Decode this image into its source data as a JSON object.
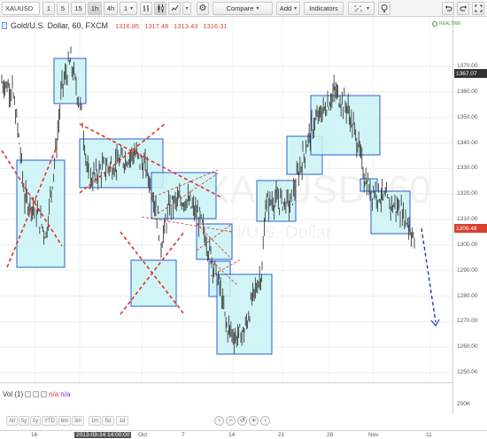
{
  "toolbar": {
    "symbol": "XAUUSD",
    "intervals": [
      "1",
      "5",
      "15",
      "1h",
      "4h",
      "1"
    ],
    "active_interval": "1h",
    "compare": "Compare",
    "add": "Add",
    "indicators": "Indicators"
  },
  "legend": {
    "title": "Gold/U.S. Dollar, 60, FXCM",
    "open": "1316.85",
    "high": "1317.48",
    "low": "1313.43",
    "close": "1316.31",
    "realtime": "REALTIME"
  },
  "watermark": {
    "line1": "XAUUSD, 60",
    "line2": "Gold/U.S. Dollar"
  },
  "price_axis": {
    "ticks": [
      "1370.00",
      "1360.00",
      "1350.00",
      "1340.00",
      "1330.00",
      "1320.00",
      "1310.00",
      "1300.00",
      "1290.00",
      "1280.00",
      "1270.00",
      "1260.00",
      "1250.00"
    ],
    "tag_top": "1367.07",
    "tag_bottom": "1306.48"
  },
  "volume": {
    "label": "Vol (1)",
    "na1": "n/a",
    "na2": "n/a",
    "tick": "200K"
  },
  "ranges": [
    "All",
    "5y",
    "1y",
    "YTD",
    "6m",
    "3m",
    "1m",
    "5d",
    "1d"
  ],
  "x_axis": {
    "ticks": [
      "16",
      "2013-09-24 14:00:00",
      "Oct",
      "7",
      "14",
      "21",
      "28",
      "Nov",
      "11"
    ]
  },
  "colors": {
    "box_fill": "#c9f3f4",
    "box_stroke": "#2b5fd0",
    "candle": "#3c3c3c",
    "cross": "#e0322a",
    "arrow": "#1f3db3"
  },
  "chart_data": {
    "type": "candlestick",
    "title": "Gold/U.S. Dollar, 60, FXCM",
    "ylim": [
      1245,
      1378
    ],
    "y_ticks": [
      1250,
      1260,
      1270,
      1280,
      1290,
      1300,
      1310,
      1320,
      1330,
      1340,
      1350,
      1360,
      1370
    ],
    "x_tick_labels": [
      "16",
      "Oct",
      "7",
      "14",
      "21",
      "28",
      "Nov",
      "11"
    ],
    "last_price": 1306.48,
    "marked_price": 1367.07,
    "grid": true
  }
}
